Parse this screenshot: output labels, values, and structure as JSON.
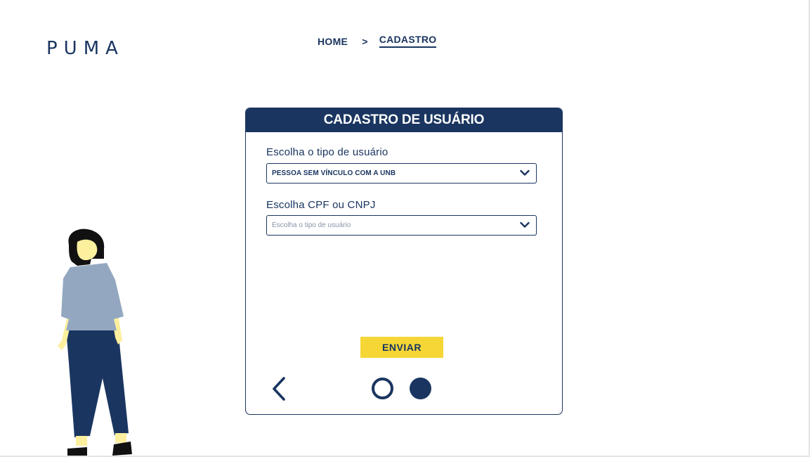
{
  "brand": {
    "logo_text": "PUMA"
  },
  "breadcrumb": {
    "home": "HOME",
    "separator": ">",
    "current": "CADASTRO"
  },
  "form": {
    "title": "CADASTRO DE USUÁRIO",
    "user_type": {
      "label": "Escolha o tipo de usuário",
      "value": "PESSOA SEM VÍNCULO COM A UNB"
    },
    "document_type": {
      "label": "Escolha CPF ou CNPJ",
      "placeholder": "Escolha o tipo de usuário"
    },
    "submit_label": "ENVIAR",
    "steps": {
      "current": 2,
      "total": 2
    }
  },
  "colors": {
    "primary": "#1a3560",
    "accent": "#f5d635",
    "shirt": "#93a8c0",
    "skin": "#fcef9e"
  },
  "icons": {
    "dropdown": "chevron-down-icon",
    "back": "chevron-left-icon"
  }
}
